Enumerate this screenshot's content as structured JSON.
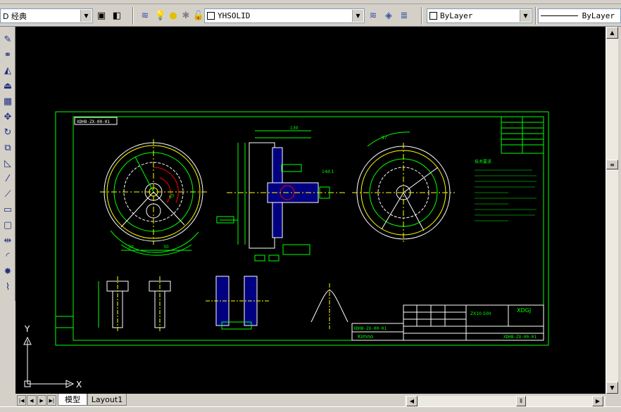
{
  "toolbar": {
    "text_style_combo": "D 经典",
    "layer_combo": "YHSOLID",
    "color_combo": "ByLayer",
    "linetype_combo": "ByLayer"
  },
  "canvas": {
    "ucs_x_label": "X",
    "ucs_y_label": "Y",
    "drawing": {
      "title_block_name": "XDGJ",
      "title_block_code": "XDH8-ZX-00-01",
      "part_label": "ZX10-500",
      "header_box_code": "XDH8-ZX-00-01",
      "company_mark": "Kimno",
      "small_label_1": "XDH8-ZX-00-01",
      "notes_title": "技术要求"
    }
  },
  "layout_tabs": [
    {
      "label": "模型",
      "active": true
    },
    {
      "label": "Layout1",
      "active": false
    }
  ],
  "colors": {
    "canvas_bg": "#000000",
    "line_green": "#00ff00",
    "line_yellow": "#ffff00",
    "line_white": "#ffffff",
    "line_red": "#ff0000",
    "line_blue": "#0000ff",
    "line_cyan": "#00ffff"
  }
}
